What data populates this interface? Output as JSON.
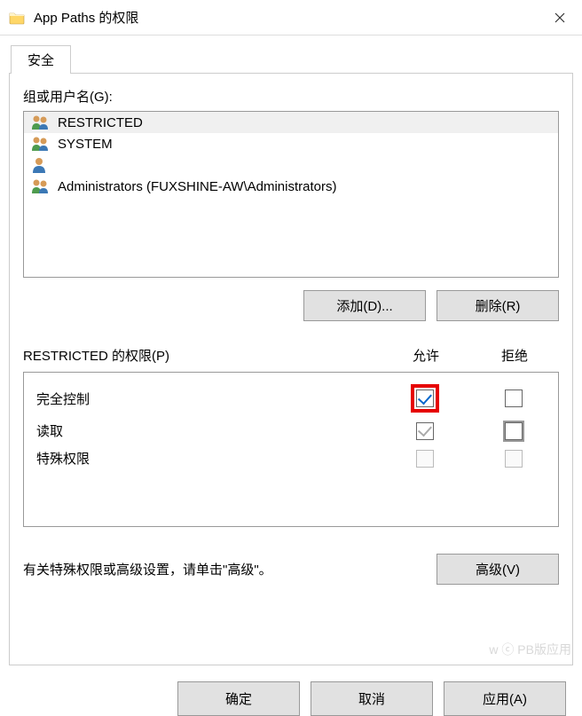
{
  "title": "App Paths 的权限",
  "tab_label": "安全",
  "groups_label": "组或用户名(G):",
  "groups": [
    {
      "name": "RESTRICTED",
      "icon": "two"
    },
    {
      "name": "SYSTEM",
      "icon": "two"
    },
    {
      "name": "",
      "icon": "one"
    },
    {
      "name": "Administrators (FUXSHINE-AW\\Administrators)",
      "icon": "two"
    }
  ],
  "add_btn": "添加(D)...",
  "remove_btn": "删除(R)",
  "perm_label": "RESTRICTED 的权限(P)",
  "allow_col": "允许",
  "deny_col": "拒绝",
  "perms": {
    "full": "完全控制",
    "read": "读取",
    "special": "特殊权限"
  },
  "perm_states": {
    "full": {
      "allow": "checked",
      "allow_highlight": true,
      "deny": ""
    },
    "read": {
      "allow": "checked-gray",
      "deny": "deny-focus"
    },
    "special": {
      "allow": "disabled",
      "deny": "disabled"
    }
  },
  "advanced_text": "有关特殊权限或高级设置，请单击\"高级\"。",
  "advanced_btn": "高级(V)",
  "ok_btn": "确定",
  "cancel_btn": "取消",
  "apply_btn": "应用(A)",
  "watermark": "w ⓒ PB版应用"
}
